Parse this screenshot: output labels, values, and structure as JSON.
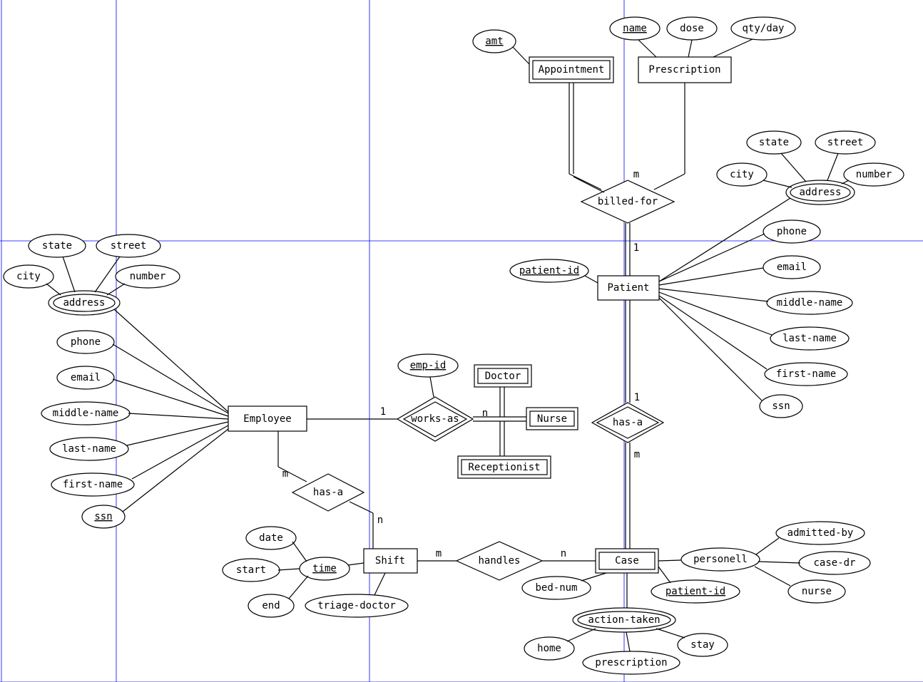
{
  "entities": {
    "appointment": "Appointment",
    "prescription": "Prescription",
    "patient": "Patient",
    "employee": "Employee",
    "doctor": "Doctor",
    "nurse": "Nurse",
    "receptionist": "Receptionist",
    "shift": "Shift",
    "case": "Case"
  },
  "relationships": {
    "billed_for": "billed-for",
    "works_as": "works-as",
    "has_a_emp": "has-a",
    "has_a_pat": "has-a",
    "handles": "handles"
  },
  "attributes": {
    "amt": "amt",
    "name": "name",
    "dose": "dose",
    "qty_day": "qty/day",
    "emp_id": "emp-id",
    "patient_id": "patient-id",
    "emp_addr": {
      "address": "address",
      "state": "state",
      "street": "street",
      "city": "city",
      "number": "number"
    },
    "emp": {
      "phone": "phone",
      "email": "email",
      "middle_name": "middle-name",
      "last_name": "last-name",
      "first_name": "first-name",
      "ssn": "ssn"
    },
    "pat_addr": {
      "address": "address",
      "state": "state",
      "street": "street",
      "city": "city",
      "number": "number"
    },
    "pat": {
      "phone": "phone",
      "email": "email",
      "middle_name": "middle-name",
      "last_name": "last-name",
      "first_name": "first-name",
      "ssn": "ssn"
    },
    "shift": {
      "date": "date",
      "start": "start",
      "end": "end",
      "time": "time",
      "triage_doctor": "triage-doctor"
    },
    "case": {
      "bed_num": "bed-num",
      "patient_id": "patient-id",
      "personell": "personell",
      "admitted_by": "admitted-by",
      "case_dr": "case-dr",
      "nurse": "nurse",
      "action_taken": "action-taken",
      "home": "home",
      "prescription": "prescription",
      "stay": "stay"
    }
  },
  "cardinalities": {
    "billed_m": "m",
    "billed_1": "1",
    "works_1": "1",
    "works_n": "n",
    "hasa_emp_m": "m",
    "hasa_emp_n": "n",
    "hasa_pat_1": "1",
    "hasa_pat_m": "m",
    "handles_m": "m",
    "handles_n": "n"
  }
}
